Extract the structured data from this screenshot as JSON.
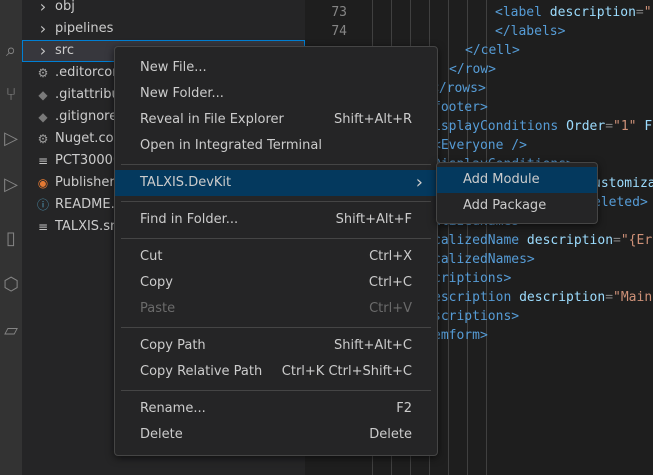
{
  "explorer": {
    "items": [
      {
        "name": "obj",
        "type": "folder",
        "icon": "chevron-right-icon"
      },
      {
        "name": "pipelines",
        "type": "folder",
        "icon": "chevron-right-icon"
      },
      {
        "name": "src",
        "type": "folder",
        "icon": "chevron-right-icon",
        "selected": true
      },
      {
        "name": ".editorconf",
        "type": "file",
        "icon": "gear-icon"
      },
      {
        "name": ".gitattribut",
        "type": "file",
        "icon": "git-icon"
      },
      {
        "name": ".gitignore",
        "type": "file",
        "icon": "git-icon"
      },
      {
        "name": "Nuget.con",
        "type": "file",
        "icon": "gear-icon"
      },
      {
        "name": "PCT30000.",
        "type": "file",
        "icon": "lines-icon"
      },
      {
        "name": "Publisher.x",
        "type": "file",
        "icon": "rss-icon"
      },
      {
        "name": "README.m",
        "type": "file",
        "icon": "info-icon"
      },
      {
        "name": "TALXIS.snk",
        "type": "file",
        "icon": "lines-icon"
      }
    ]
  },
  "editor": {
    "line_numbers": [
      "73",
      "74"
    ],
    "lines": [
      {
        "tag_open": "<label ",
        "attr": "description",
        "eq": "=",
        "str": "\"",
        "rest": ""
      },
      {
        "tag_open": "</labels>"
      },
      {
        "tag_open": "</cell>"
      },
      {
        "tag_open": "</row>"
      },
      {
        "tag_open": "</rows>"
      },
      {
        "tag_open": "footer>"
      },
      {
        "tag_open": "isplayConditions ",
        "attr": "Order",
        "eq": "=",
        "str": "\"1\"",
        "rest": " Fa"
      },
      {
        "tag_open": "<Everyone />"
      },
      {
        "tag_open": "DisplayConditions>"
      },
      {
        "tag_open": "",
        "attr": "ustomizable"
      },
      {
        "tag_open": "eleted>"
      },
      {
        "tag_open": "alizedNames>"
      },
      {
        "tag_open": "calizedName ",
        "attr": "description",
        "eq": "=",
        "str": "\"{Er"
      },
      {
        "tag_open": "calizedNames>"
      },
      {
        "tag_open": "criptions>"
      },
      {
        "tag_open": "escription ",
        "attr": "description",
        "eq": "=",
        "str": "\"Main"
      },
      {
        "tag_open": "scriptions>"
      },
      {
        "tag_open": "emform>"
      }
    ]
  },
  "context_menu": {
    "groups": [
      [
        {
          "label": "New File...",
          "shortcut": ""
        },
        {
          "label": "New Folder...",
          "shortcut": ""
        },
        {
          "label": "Reveal in File Explorer",
          "shortcut": "Shift+Alt+R"
        },
        {
          "label": "Open in Integrated Terminal",
          "shortcut": ""
        }
      ],
      [
        {
          "label": "TALXIS.DevKit",
          "shortcut": "",
          "submenu": true,
          "active": true
        }
      ],
      [
        {
          "label": "Find in Folder...",
          "shortcut": "Shift+Alt+F"
        }
      ],
      [
        {
          "label": "Cut",
          "shortcut": "Ctrl+X"
        },
        {
          "label": "Copy",
          "shortcut": "Ctrl+C"
        },
        {
          "label": "Paste",
          "shortcut": "Ctrl+V",
          "disabled": true
        }
      ],
      [
        {
          "label": "Copy Path",
          "shortcut": "Shift+Alt+C"
        },
        {
          "label": "Copy Relative Path",
          "shortcut": "Ctrl+K Ctrl+Shift+C"
        }
      ],
      [
        {
          "label": "Rename...",
          "shortcut": "F2"
        },
        {
          "label": "Delete",
          "shortcut": "Delete"
        }
      ]
    ]
  },
  "submenu": {
    "items": [
      {
        "label": "Add Module",
        "active": true
      },
      {
        "label": "Add Package"
      }
    ]
  },
  "colors": {
    "accent": "#007fd4",
    "menu_active": "#04395e",
    "tag": "#569cd6",
    "attribute": "#9cdcfe",
    "string": "#ce9178"
  }
}
